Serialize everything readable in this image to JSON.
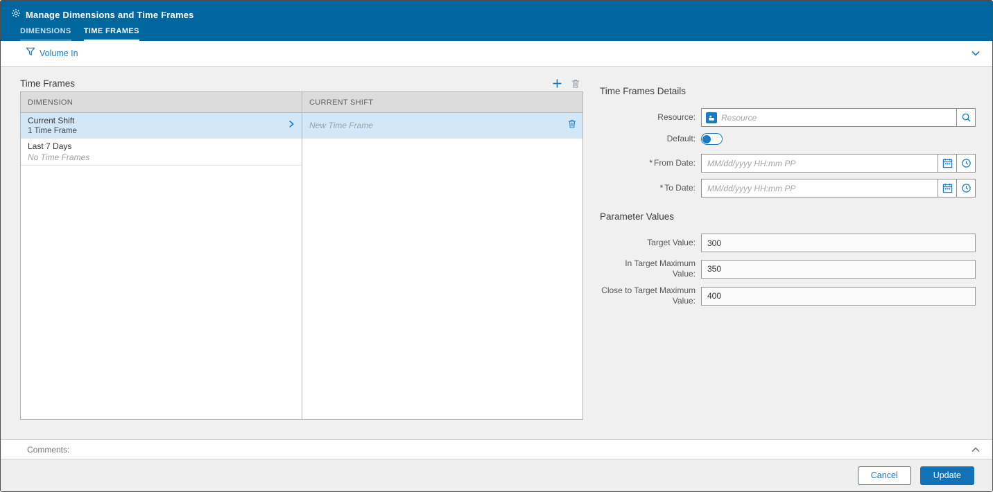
{
  "header": {
    "title": "Manage Dimensions and Time Frames",
    "tabs": [
      {
        "label": "DIMENSIONS",
        "active": false
      },
      {
        "label": "TIME FRAMES",
        "active": true
      }
    ]
  },
  "filter": {
    "label": "Volume In"
  },
  "time_frames": {
    "section_title": "Time Frames",
    "columns": [
      "DIMENSION",
      "CURRENT SHIFT"
    ],
    "dimension_rows": [
      {
        "name": "Current Shift",
        "sub": "1 Time Frame",
        "selected": true
      },
      {
        "name": "Last 7 Days",
        "sub": "No Time Frames",
        "selected": false
      }
    ],
    "time_frame_rows": [
      {
        "name": "New Time Frame",
        "selected": true
      }
    ]
  },
  "details": {
    "title": "Time Frames Details",
    "resource_label": "Resource:",
    "resource_placeholder": "Resource",
    "default_label": "Default:",
    "required_marker": "*",
    "from_date_label": "From Date:",
    "to_date_label": "To Date:",
    "date_placeholder": "MM/dd/yyyy HH:mm PP"
  },
  "parameters": {
    "title": "Parameter Values",
    "fields": [
      {
        "label": "Target Value:",
        "value": "300"
      },
      {
        "label": "In Target Maximum Value:",
        "value": "350"
      },
      {
        "label": "Close to Target Maximum Value:",
        "value": "400"
      }
    ]
  },
  "comments": {
    "label": "Comments:"
  },
  "footer": {
    "cancel_label": "Cancel",
    "update_label": "Update"
  },
  "colors": {
    "header_bg": "#00669e",
    "accent": "#1b7ac0",
    "selected_row": "#d2e8f8",
    "update_button": "#1272b8"
  }
}
